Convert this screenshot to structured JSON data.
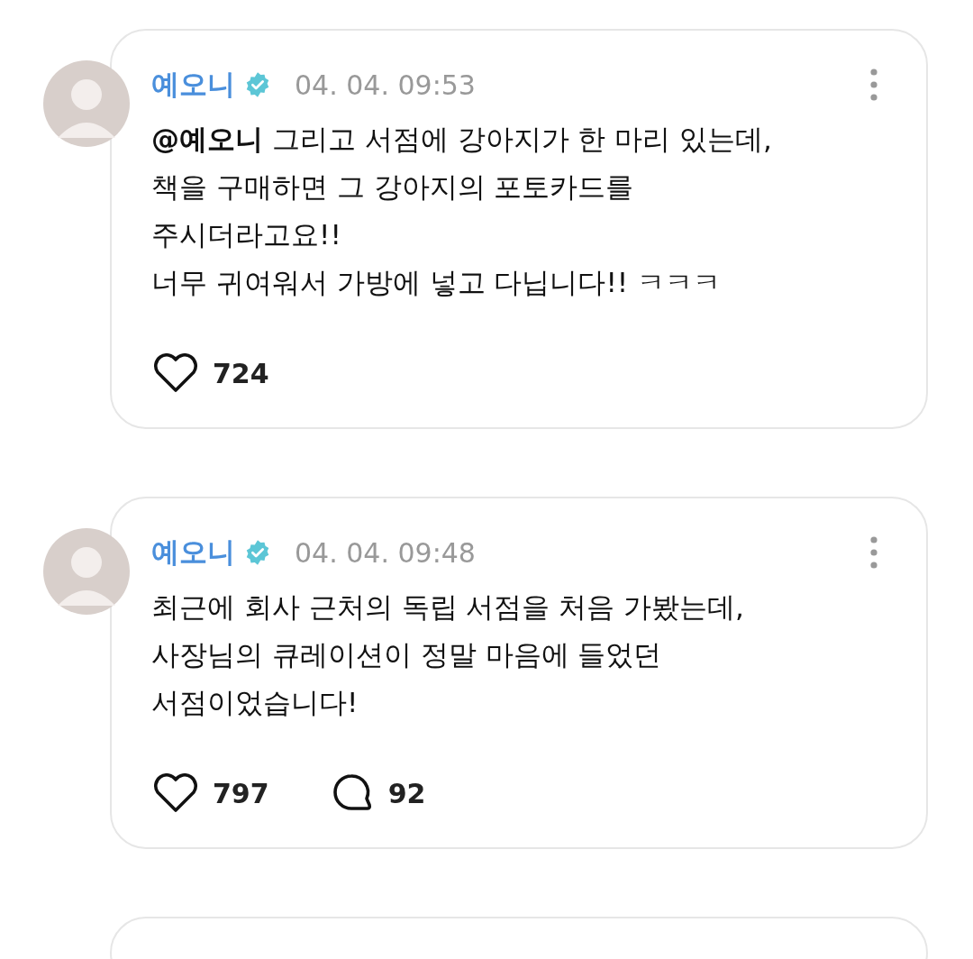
{
  "posts": [
    {
      "author": "예오니",
      "verified": true,
      "time": "04. 04. 09:53",
      "body": "**@예오니** 그리고 서점에 강아지가 한 마리 있는데,\n책을 구매하면 그 강아지의 포토카드를\n주시더라고요!!\n너무 귀여워서 가방에 넣고 다닙니다!! ㅋㅋㅋ",
      "likes": "724"
    },
    {
      "author": "예오니",
      "verified": true,
      "time": "04. 04. 09:48",
      "body": "최근에 회사 근처의 독립 서점을 처음 가봤는데,\n사장님의 큐레이션이 정말 마음에 들었던\n서점이었습니다!",
      "likes": "797",
      "comments": "92"
    }
  ]
}
